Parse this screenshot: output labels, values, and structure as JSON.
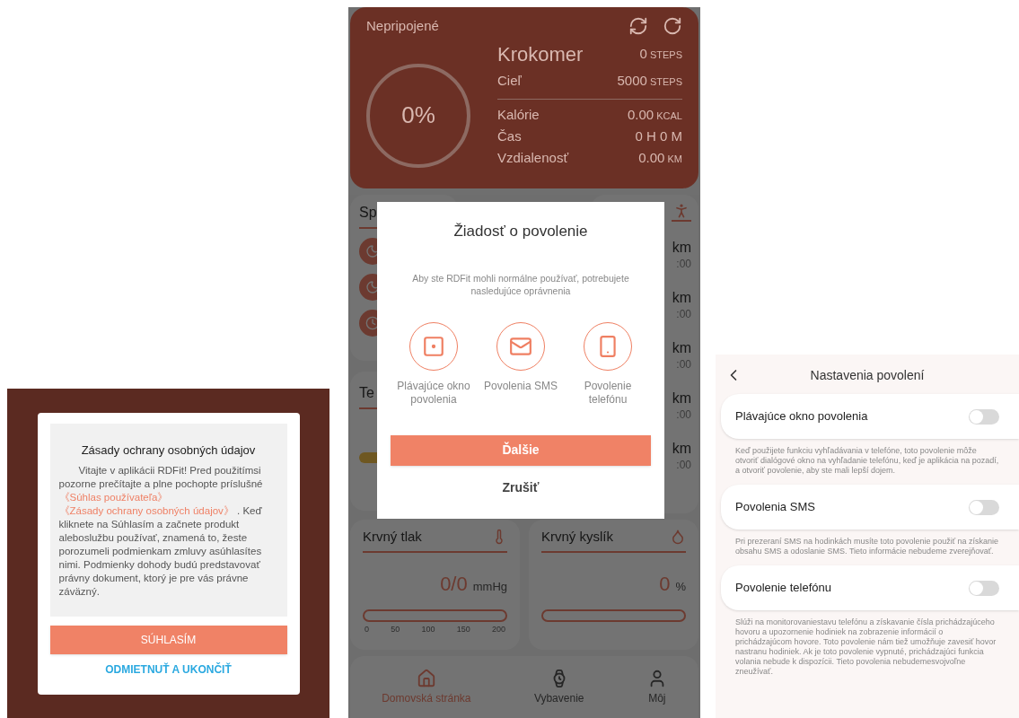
{
  "privacy_dialog": {
    "title": "Zásady ochrany osobných údajov",
    "body": [
      {
        "kind": "text",
        "text": "Vitajte v aplikácii RDFit! Pred použitímsi pozorne prečítajte a plne pochopte príslušné "
      },
      {
        "kind": "link",
        "text": "《Súhlas používateľa》"
      },
      {
        "kind": "link",
        "text": "《Zásady ochrany osobných údajov》"
      },
      {
        "kind": "text",
        "text": " . Keď kliknete na Súhlasím a začnete produkt aleboslužbu používať, znamená to, žeste porozumeli podmienkam zmluvy asúhlasítes nimi. Podmienky dohody budú predstavovať právny dokument, ktorý je pre vás právne záväzný."
      }
    ],
    "accept": "SÚHLASÍM",
    "decline": "ODMIETNUŤ A UKONČIŤ"
  },
  "home": {
    "status": "Nepripojené",
    "progress": "0%",
    "stats": [
      {
        "kind": "main",
        "label": "Krokomer",
        "value": "0",
        "unit": "STEPS"
      },
      {
        "kind": "goal",
        "label": "Cieľ",
        "value": "5000",
        "unit": "STEPS"
      },
      {
        "kind": "plain",
        "label": "Kalórie",
        "value": "0.00",
        "unit": "KCAL"
      },
      {
        "kind": "plain",
        "label": "Čas",
        "value": "0 H 0 M"
      },
      {
        "kind": "plain",
        "label": "Vzdialenosť",
        "value": "0.00",
        "unit": "KM"
      }
    ],
    "card_1": {
      "title": "Sp"
    },
    "card_2": {
      "title": "Te"
    },
    "card_3_rows": [
      {
        "column_1": "km",
        "column_2": ":00"
      },
      {
        "column_1": "km",
        "column_2": ":00"
      },
      {
        "column_1": "km",
        "column_2": ":00"
      },
      {
        "column_1": "km",
        "column_2": ":00"
      },
      {
        "column_1": "km",
        "column_2": ":00"
      }
    ],
    "blood_pressure": {
      "title": "Krvný tlak",
      "value": "0/0",
      "unit": "mmHg",
      "scale": [
        "0",
        "50",
        "100",
        "150",
        "200"
      ]
    },
    "blood_oxygen": {
      "title": "Krvný kyslík",
      "value": "0",
      "unit": "%"
    },
    "nav": [
      {
        "kind": "home",
        "label": "Domovská stránka",
        "selected": true
      },
      {
        "kind": "watch",
        "label": "Vybavenie",
        "selected": false
      },
      {
        "kind": "user",
        "label": "Môj",
        "selected": false
      }
    ]
  },
  "permission_dialog": {
    "title": "Žiadosť o povolenie",
    "description": "Aby ste RDFit mohli normálne používať, potrebujete nasledujúce oprávnenia",
    "permissions": [
      {
        "kind": "window",
        "label": "Plávajúce okno povolenia"
      },
      {
        "kind": "sms",
        "label": "Povolenia SMS"
      },
      {
        "kind": "phone",
        "label": "Povolenie telefónu"
      }
    ],
    "primary": "Ďalšie",
    "secondary": "Zrušiť"
  },
  "settings": {
    "title": "Nastavenia povolení",
    "items": [
      {
        "label": "Plávajúce okno povolenia",
        "on": false,
        "description": "Keď použijete funkciu vyhľadávania v telefóne, toto povolenie môže otvoriť dialógové okno na vyhľadanie telefónu, keď je aplikácia na pozadí, a otvoriť povolenie, aby ste mali lepší dojem."
      },
      {
        "label": "Povolenia SMS",
        "on": false,
        "description": "Pri prezeraní SMS na hodinkách musíte toto povolenie použiť na získanie obsahu SMS a odoslanie SMS. Tieto informácie nebudeme zverejňovať."
      },
      {
        "label": "Povolenie telefónu",
        "on": false,
        "description": "Slúži na monitorovaniestavu telefónu a získavanie čísla prichádzajúceho hovoru a upozornenie hodiniek na zobrazenie informácií o prichádzajúcom hovore. Toto povolenie nám tiež umožňuje zavesiť hovor nastranu hodiniek. Ak je toto povolenie vypnuté, prichádzajúci funkcia volania nebude k dispozícii. Tieto povolenia nebudemesvojvoľne zneužívať."
      }
    ]
  }
}
